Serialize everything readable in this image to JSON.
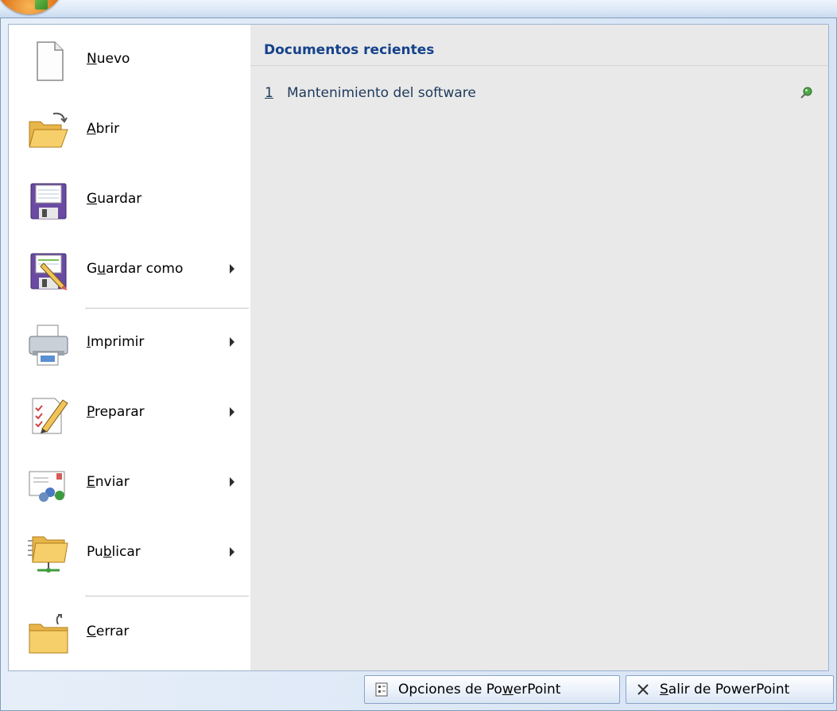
{
  "menu": {
    "items": [
      {
        "id": "nuevo",
        "pre": "",
        "key": "N",
        "post": "uevo",
        "has_submenu": false,
        "icon": "new-document-icon"
      },
      {
        "id": "abrir",
        "pre": "",
        "key": "A",
        "post": "brir",
        "has_submenu": false,
        "icon": "open-folder-icon"
      },
      {
        "id": "guardar",
        "pre": "",
        "key": "G",
        "post": "uardar",
        "has_submenu": false,
        "icon": "save-disk-icon"
      },
      {
        "id": "guardar-como",
        "pre": "G",
        "key": "u",
        "post": "ardar como",
        "has_submenu": true,
        "icon": "save-as-icon"
      },
      {
        "id": "imprimir",
        "pre": "",
        "key": "I",
        "post": "mprimir",
        "has_submenu": true,
        "icon": "printer-icon"
      },
      {
        "id": "preparar",
        "pre": "",
        "key": "P",
        "post": "reparar",
        "has_submenu": true,
        "icon": "prepare-document-icon"
      },
      {
        "id": "enviar",
        "pre": "",
        "key": "E",
        "post": "nviar",
        "has_submenu": true,
        "icon": "send-icon"
      },
      {
        "id": "publicar",
        "pre": "Pu",
        "key": "b",
        "post": "licar",
        "has_submenu": true,
        "icon": "publish-folder-icon"
      },
      {
        "id": "cerrar",
        "pre": "",
        "key": "C",
        "post": "errar",
        "has_submenu": false,
        "icon": "close-folder-icon"
      }
    ]
  },
  "recent": {
    "title": "Documentos recientes",
    "items": [
      {
        "number": "1",
        "name": "Mantenimiento del software",
        "icon": "pin-icon"
      }
    ]
  },
  "footer": {
    "options": {
      "pre": "Opciones de Po",
      "key": "w",
      "post": "erPoint",
      "icon": "options-icon"
    },
    "exit": {
      "pre": "",
      "key": "S",
      "post": "alir de PowerPoint",
      "icon": "close-x-icon"
    }
  },
  "colors": {
    "accent": "#15428b",
    "menu_background": "#e9e9e9",
    "frame_border": "#7f9db9"
  }
}
